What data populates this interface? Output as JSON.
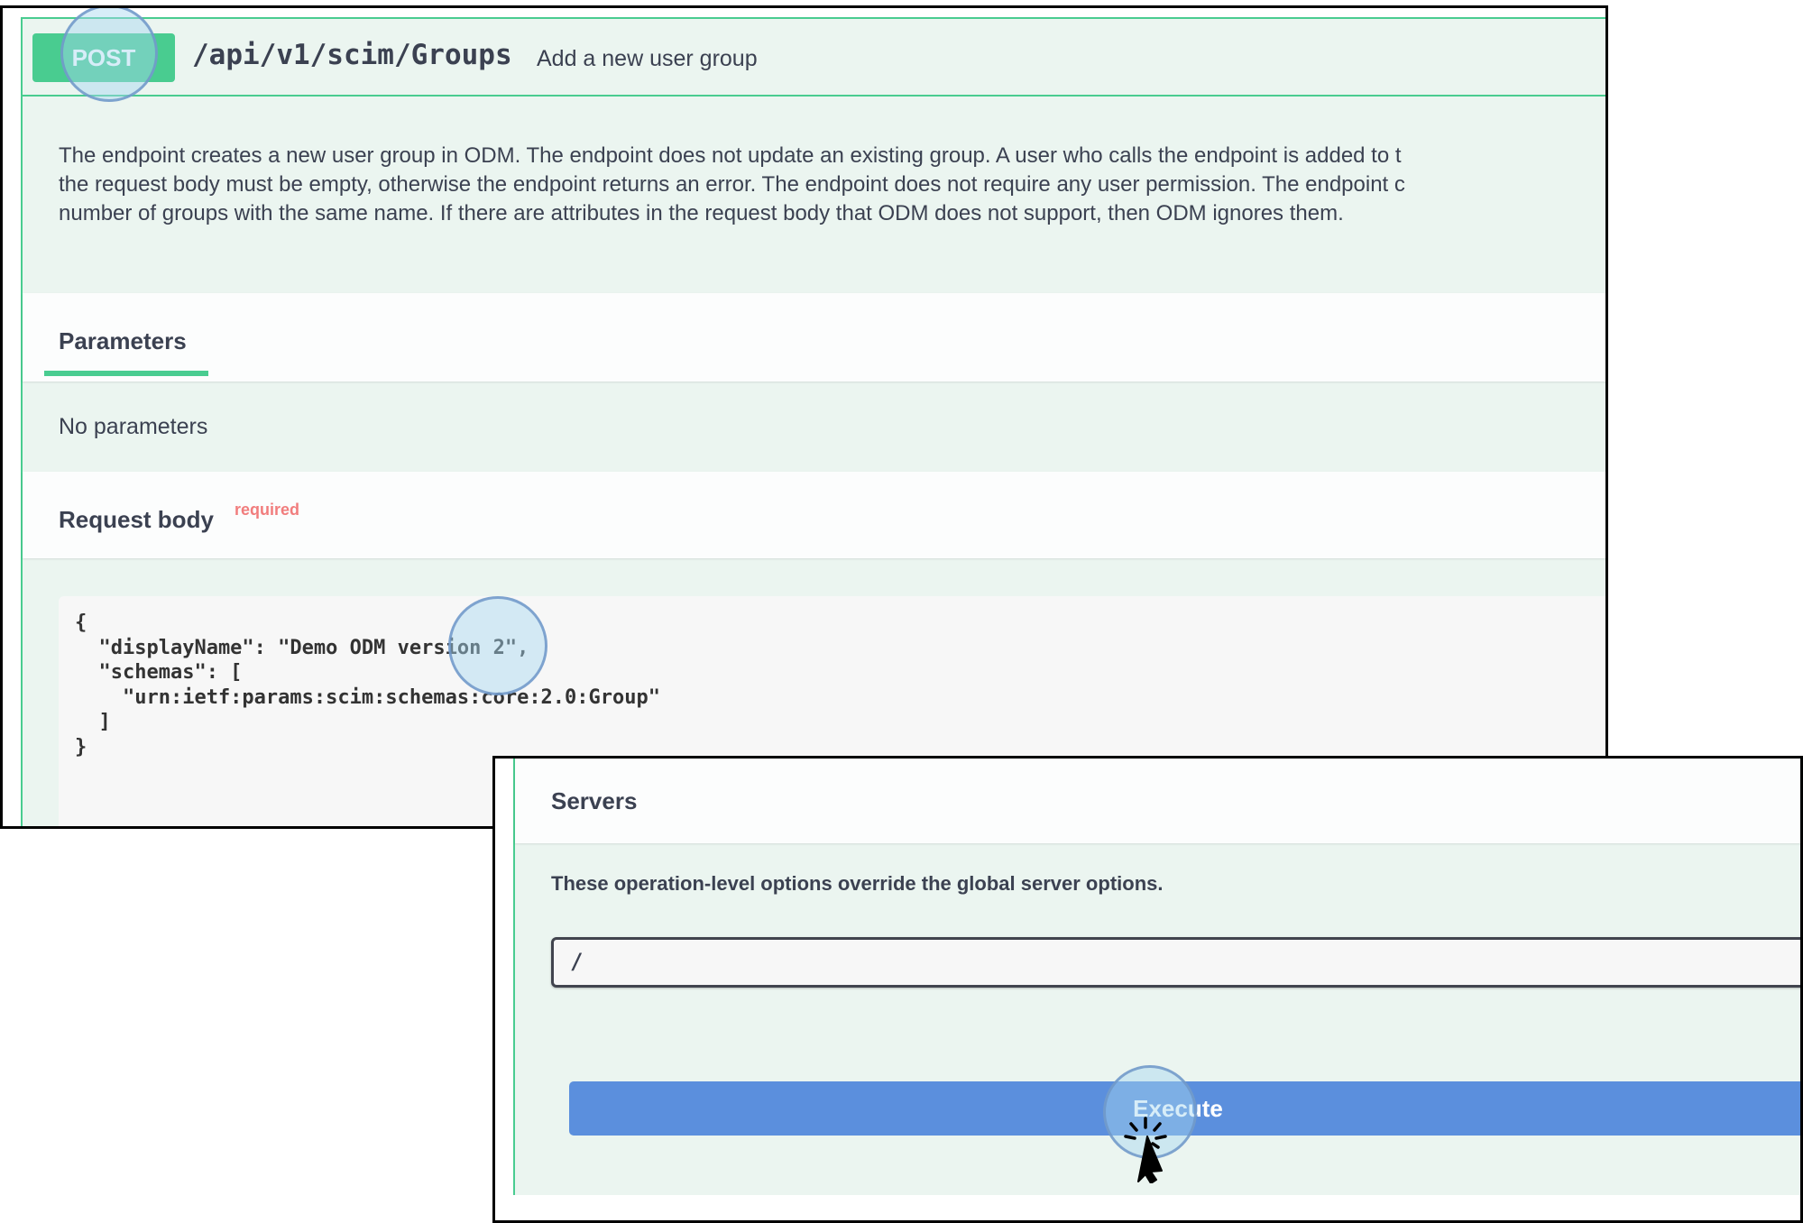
{
  "endpoint": {
    "method": "POST",
    "path": "/api/v1/scim/Groups",
    "summary": "Add a new user group",
    "description_lines": [
      "The endpoint creates a new user group in ODM. The endpoint does not update an existing group. A user who calls the endpoint is added to t",
      "the request body must be empty, otherwise the endpoint returns an error. The endpoint does not require any user permission. The endpoint c",
      "number of groups with the same name. If there are attributes in the request body that ODM does not support, then ODM ignores them."
    ]
  },
  "parameters": {
    "tab_label": "Parameters",
    "empty_text": "No parameters"
  },
  "request_body": {
    "title": "Request body",
    "required_label": "required",
    "code_lines": [
      "{",
      "  \"displayName\": \"Demo ODM version 2\",",
      "  \"schemas\": [",
      "    \"urn:ietf:params:scim:schemas:core:2.0:Group\"",
      "  ]",
      "}"
    ]
  },
  "servers": {
    "title": "Servers",
    "note": "These operation-level options override the global server options.",
    "selected": "/"
  },
  "execute": {
    "label": "Execute"
  },
  "colors": {
    "post_green": "#49cc90",
    "opblock_bg": "#ebf5f0",
    "execute_blue": "#5b8fdd",
    "required_red": "#f17d7d",
    "text": "#3b4151"
  },
  "icons": {
    "cursor": "pointer-cursor-icon"
  }
}
